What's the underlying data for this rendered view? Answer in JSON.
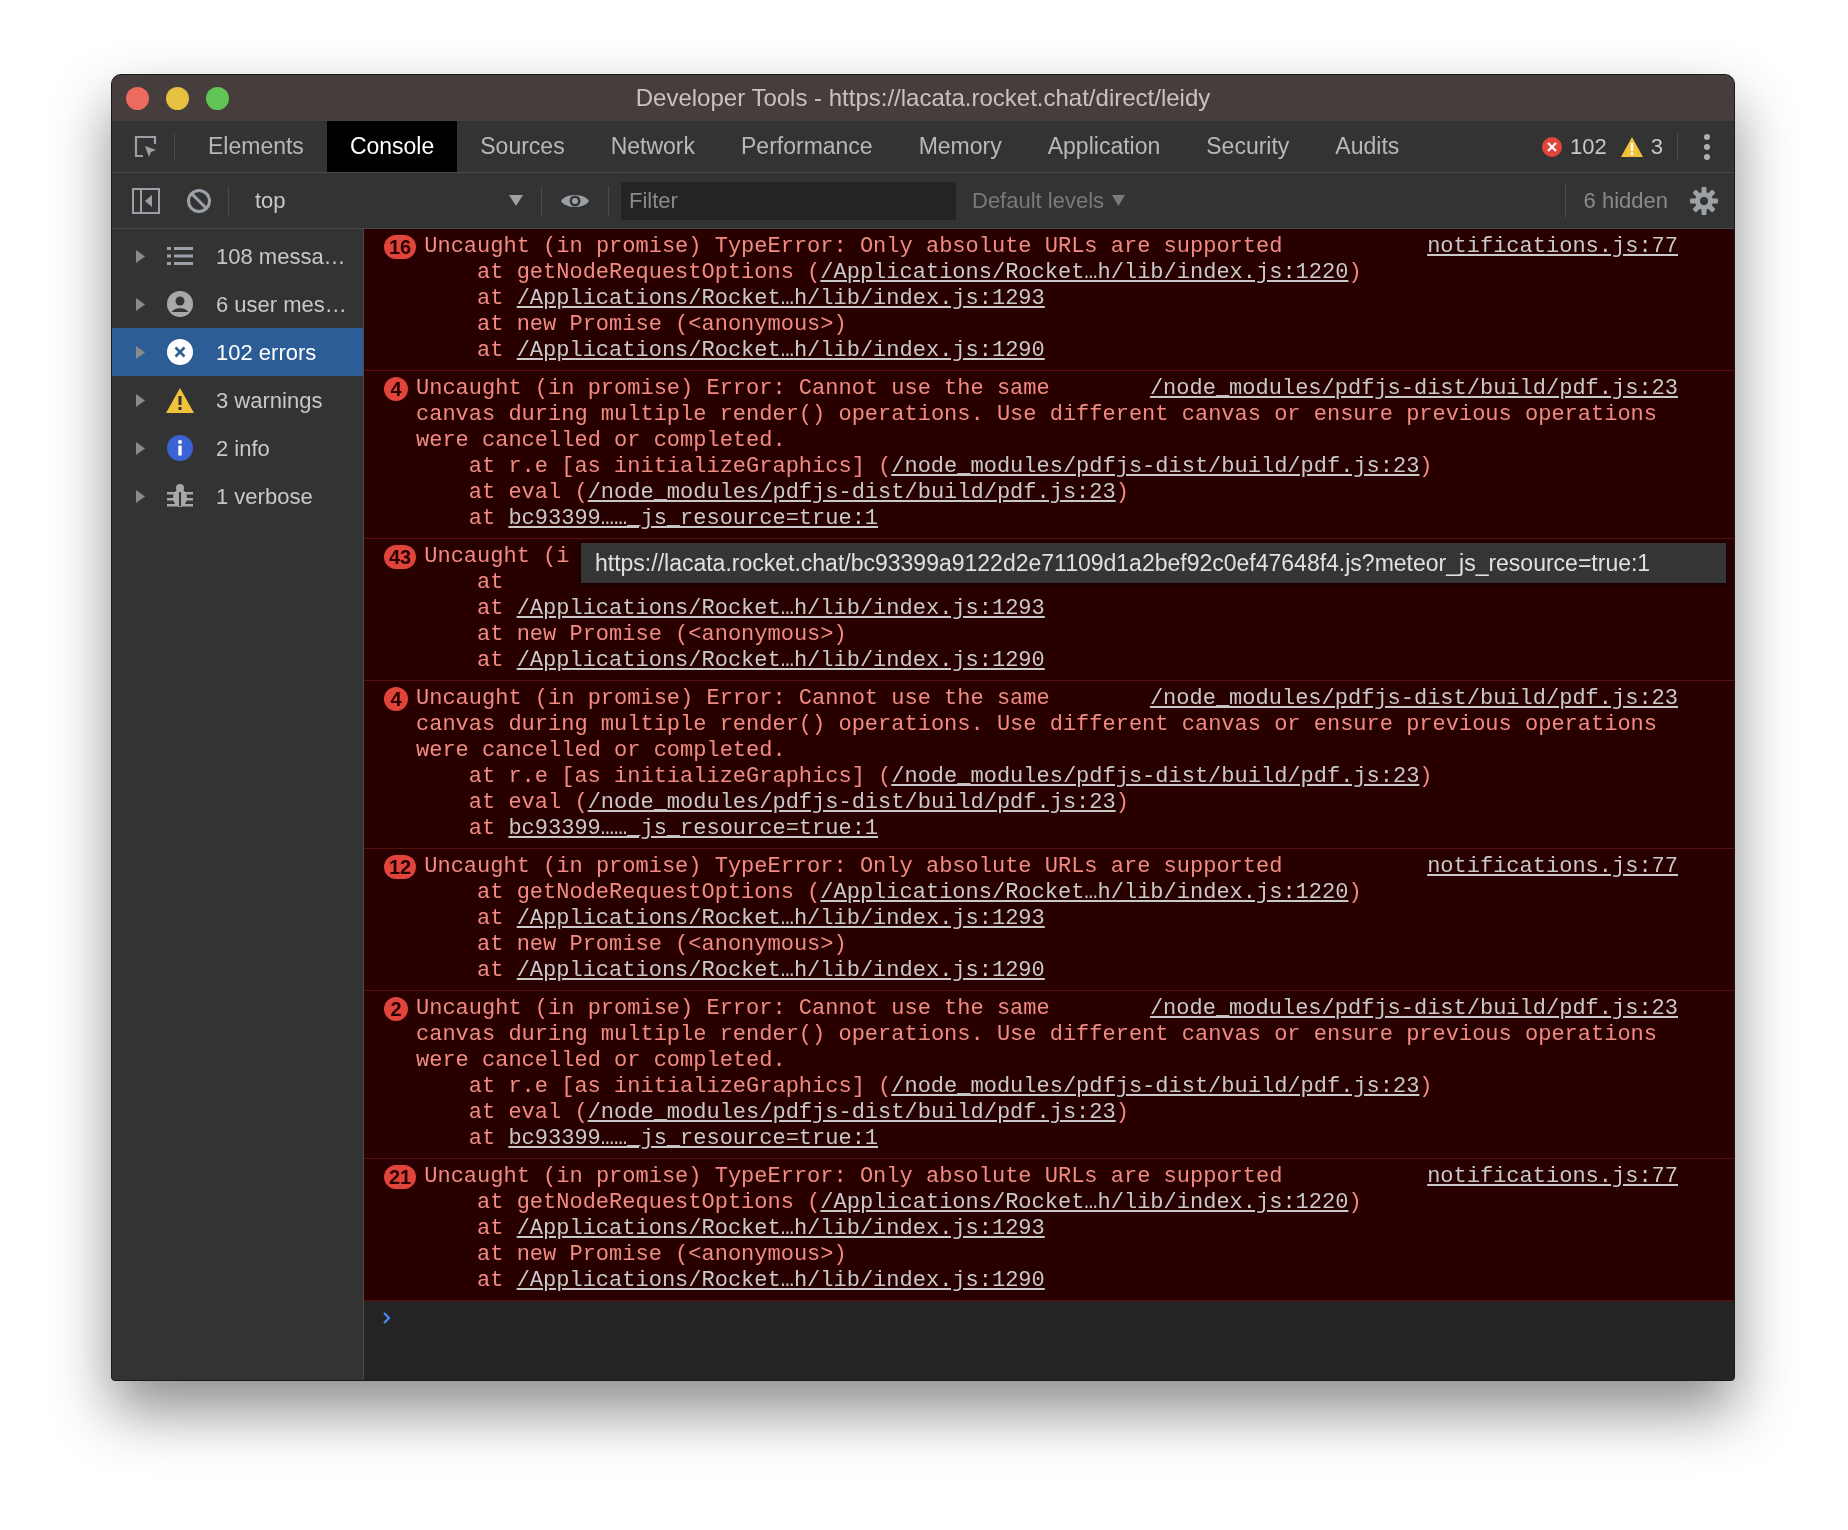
{
  "window": {
    "title": "Developer Tools - https://lacata.rocket.chat/direct/leidy"
  },
  "tabs": [
    {
      "label": "Elements",
      "selected": false
    },
    {
      "label": "Console",
      "selected": true
    },
    {
      "label": "Sources",
      "selected": false
    },
    {
      "label": "Network",
      "selected": false
    },
    {
      "label": "Performance",
      "selected": false
    },
    {
      "label": "Memory",
      "selected": false
    },
    {
      "label": "Application",
      "selected": false
    },
    {
      "label": "Security",
      "selected": false
    },
    {
      "label": "Audits",
      "selected": false
    }
  ],
  "issue_counts": {
    "errors": "102",
    "warnings": "3"
  },
  "toolbar": {
    "context": "top",
    "filter": {
      "placeholder": "Filter"
    },
    "levels": "Default levels",
    "hidden": "6 hidden"
  },
  "sidebar": {
    "items": [
      {
        "kind": "messages",
        "label": "108 messa…",
        "selected": false,
        "expanded": false
      },
      {
        "kind": "user",
        "label": "6 user mes…",
        "selected": false,
        "expanded": false
      },
      {
        "kind": "errors",
        "label": "102 errors",
        "selected": true,
        "expanded": false
      },
      {
        "kind": "warnings",
        "label": "3 warnings",
        "selected": false,
        "expanded": false
      },
      {
        "kind": "info",
        "label": "2 info",
        "selected": false,
        "expanded": false
      },
      {
        "kind": "verbose",
        "label": "1 verbose",
        "selected": false,
        "expanded": false
      }
    ]
  },
  "messages": [
    {
      "count": "16",
      "text": [
        "Uncaught (in promise) TypeError: Only absolute URLs are supported"
      ],
      "source": "notifications.js:77",
      "stack": [
        {
          "text": "at getNodeRequestOptions (",
          "link": "/Applications/Rocket…h/lib/index.js:1220",
          "after": ")"
        },
        {
          "text": "at ",
          "link": "/Applications/Rocket…h/lib/index.js:1293"
        },
        {
          "text": "at new Promise (<anonymous>)"
        },
        {
          "text": "at ",
          "link": "/Applications/Rocket…h/lib/index.js:1290"
        }
      ]
    },
    {
      "count": "4",
      "text": [
        "Uncaught (in promise) Error: Cannot use the same",
        "canvas during multiple render() operations. Use different canvas or ensure previous operations",
        "were cancelled or completed."
      ],
      "source": "/node_modules/pdfjs-dist/build/pdf.js:23",
      "stack": [
        {
          "text": "at r.e [as initializeGraphics] (",
          "link": "/node_modules/pdfjs-dist/build/pdf.js:23",
          "after": ")"
        },
        {
          "text": "at eval (",
          "link": "/node_modules/pdfjs-dist/build/pdf.js:23",
          "after": ")"
        },
        {
          "text": "at ",
          "link": "bc93399……_js_resource=true:1"
        }
      ]
    },
    {
      "count": "43",
      "text": [
        "Uncaught (i"
      ],
      "tooltip": "https://lacata.rocket.chat/bc93399a9122d2e71109d1a2bef92c0ef47648f4.js?meteor_js_resource=true:1",
      "stack": [
        {
          "text": "at "
        },
        {
          "text": "at ",
          "link": "/Applications/Rocket…h/lib/index.js:1293"
        },
        {
          "text": "at new Promise (<anonymous>)"
        },
        {
          "text": "at ",
          "link": "/Applications/Rocket…h/lib/index.js:1290"
        }
      ]
    },
    {
      "count": "4",
      "text": [
        "Uncaught (in promise) Error: Cannot use the same",
        "canvas during multiple render() operations. Use different canvas or ensure previous operations",
        "were cancelled or completed."
      ],
      "source": "/node_modules/pdfjs-dist/build/pdf.js:23",
      "stack": [
        {
          "text": "at r.e [as initializeGraphics] (",
          "link": "/node_modules/pdfjs-dist/build/pdf.js:23",
          "after": ")"
        },
        {
          "text": "at eval (",
          "link": "/node_modules/pdfjs-dist/build/pdf.js:23",
          "after": ")"
        },
        {
          "text": "at ",
          "link": "bc93399……_js_resource=true:1"
        }
      ]
    },
    {
      "count": "12",
      "text": [
        "Uncaught (in promise) TypeError: Only absolute URLs are supported"
      ],
      "source": "notifications.js:77",
      "stack": [
        {
          "text": "at getNodeRequestOptions (",
          "link": "/Applications/Rocket…h/lib/index.js:1220",
          "after": ")"
        },
        {
          "text": "at ",
          "link": "/Applications/Rocket…h/lib/index.js:1293"
        },
        {
          "text": "at new Promise (<anonymous>)"
        },
        {
          "text": "at ",
          "link": "/Applications/Rocket…h/lib/index.js:1290"
        }
      ]
    },
    {
      "count": "2",
      "text": [
        "Uncaught (in promise) Error: Cannot use the same",
        "canvas during multiple render() operations. Use different canvas or ensure previous operations",
        "were cancelled or completed."
      ],
      "source": "/node_modules/pdfjs-dist/build/pdf.js:23",
      "stack": [
        {
          "text": "at r.e [as initializeGraphics] (",
          "link": "/node_modules/pdfjs-dist/build/pdf.js:23",
          "after": ")"
        },
        {
          "text": "at eval (",
          "link": "/node_modules/pdfjs-dist/build/pdf.js:23",
          "after": ")"
        },
        {
          "text": "at ",
          "link": "bc93399……_js_resource=true:1"
        }
      ]
    },
    {
      "count": "21",
      "text": [
        "Uncaught (in promise) TypeError: Only absolute URLs are supported"
      ],
      "source": "notifications.js:77",
      "stack": [
        {
          "text": "at getNodeRequestOptions (",
          "link": "/Applications/Rocket…h/lib/index.js:1220",
          "after": ")"
        },
        {
          "text": "at ",
          "link": "/Applications/Rocket…h/lib/index.js:1293"
        },
        {
          "text": "at new Promise (<anonymous>)"
        },
        {
          "text": "at ",
          "link": "/Applications/Rocket…h/lib/index.js:1290"
        }
      ]
    }
  ]
}
